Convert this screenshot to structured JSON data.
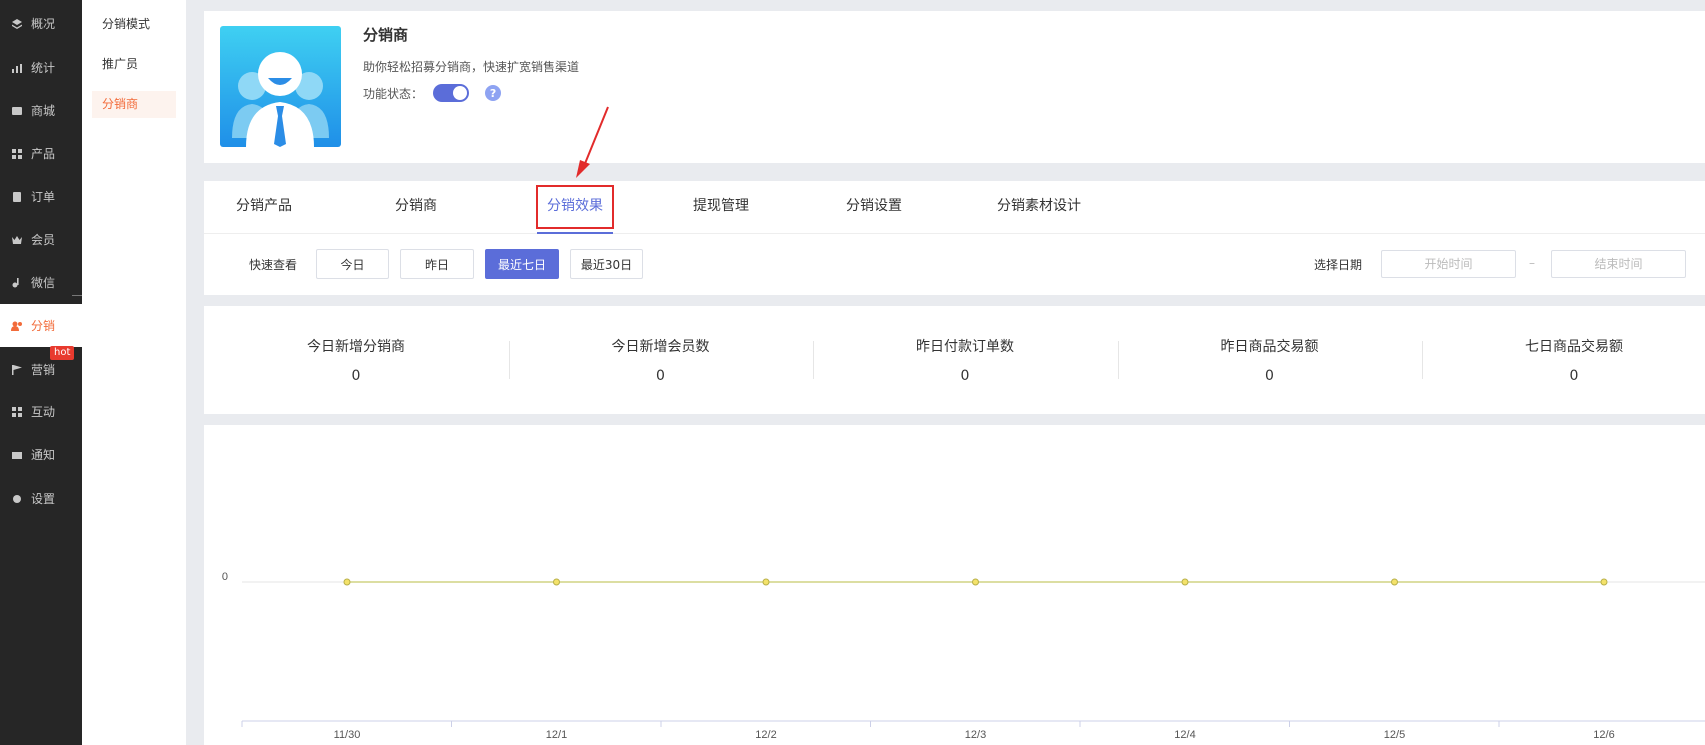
{
  "nav": {
    "items": [
      {
        "label": "概况",
        "icon": "layers-icon"
      },
      {
        "label": "统计",
        "icon": "stats-icon"
      },
      {
        "label": "商城",
        "icon": "mall-icon"
      },
      {
        "label": "产品",
        "icon": "grid-icon"
      },
      {
        "label": "订单",
        "icon": "order-icon"
      },
      {
        "label": "会员",
        "icon": "crown-icon"
      },
      {
        "label": "微信",
        "icon": "wechat-icon"
      },
      {
        "label": "分销",
        "icon": "distribution-icon",
        "active": true
      },
      {
        "label": "营销",
        "icon": "flag-icon"
      },
      {
        "label": "互动",
        "icon": "interact-icon"
      },
      {
        "label": "通知",
        "icon": "mail-icon"
      },
      {
        "label": "设置",
        "icon": "gear-icon"
      }
    ],
    "hot_badge": "hot"
  },
  "subnav": {
    "items": [
      {
        "label": "分销模式"
      },
      {
        "label": "推广员"
      },
      {
        "label": "分销商",
        "active": true
      }
    ]
  },
  "header": {
    "title": "分销商",
    "description": "助你轻松招募分销商，快速扩宽销售渠道",
    "status_label": "功能状态：",
    "help_icon": "?",
    "toggle_on": true
  },
  "tabs": [
    {
      "label": "分销产品"
    },
    {
      "label": "分销商"
    },
    {
      "label": "分销效果",
      "active": true
    },
    {
      "label": "提现管理"
    },
    {
      "label": "分销设置"
    },
    {
      "label": "分销素材设计"
    }
  ],
  "filters": {
    "quick_label": "快速查看",
    "buttons": [
      {
        "label": "今日"
      },
      {
        "label": "昨日"
      },
      {
        "label": "最近七日",
        "active": true
      },
      {
        "label": "最近30日"
      }
    ],
    "date_label": "选择日期",
    "start_placeholder": "开始时间",
    "date_separator": "–",
    "end_placeholder": "结束时间"
  },
  "stats": [
    {
      "label": "今日新增分销商",
      "value": "0"
    },
    {
      "label": "今日新增会员数",
      "value": "0"
    },
    {
      "label": "昨日付款订单数",
      "value": "0"
    },
    {
      "label": "昨日商品交易额",
      "value": "0"
    },
    {
      "label": "七日商品交易额",
      "value": "0"
    }
  ],
  "chart_data": {
    "type": "line",
    "categories": [
      "11/30",
      "12/1",
      "12/2",
      "12/3",
      "12/4",
      "12/5",
      "12/6"
    ],
    "series": [
      {
        "values": [
          0,
          0,
          0,
          0,
          0,
          0,
          0
        ],
        "color": "#c8c96a"
      }
    ],
    "yticks": [
      "0"
    ],
    "title": "",
    "xlabel": "",
    "ylabel": ""
  },
  "colors": {
    "accent": "#5b6dd9",
    "active_orange": "#f26b3a",
    "nav_bg": "#262626",
    "highlight_red": "#e22b2b"
  }
}
